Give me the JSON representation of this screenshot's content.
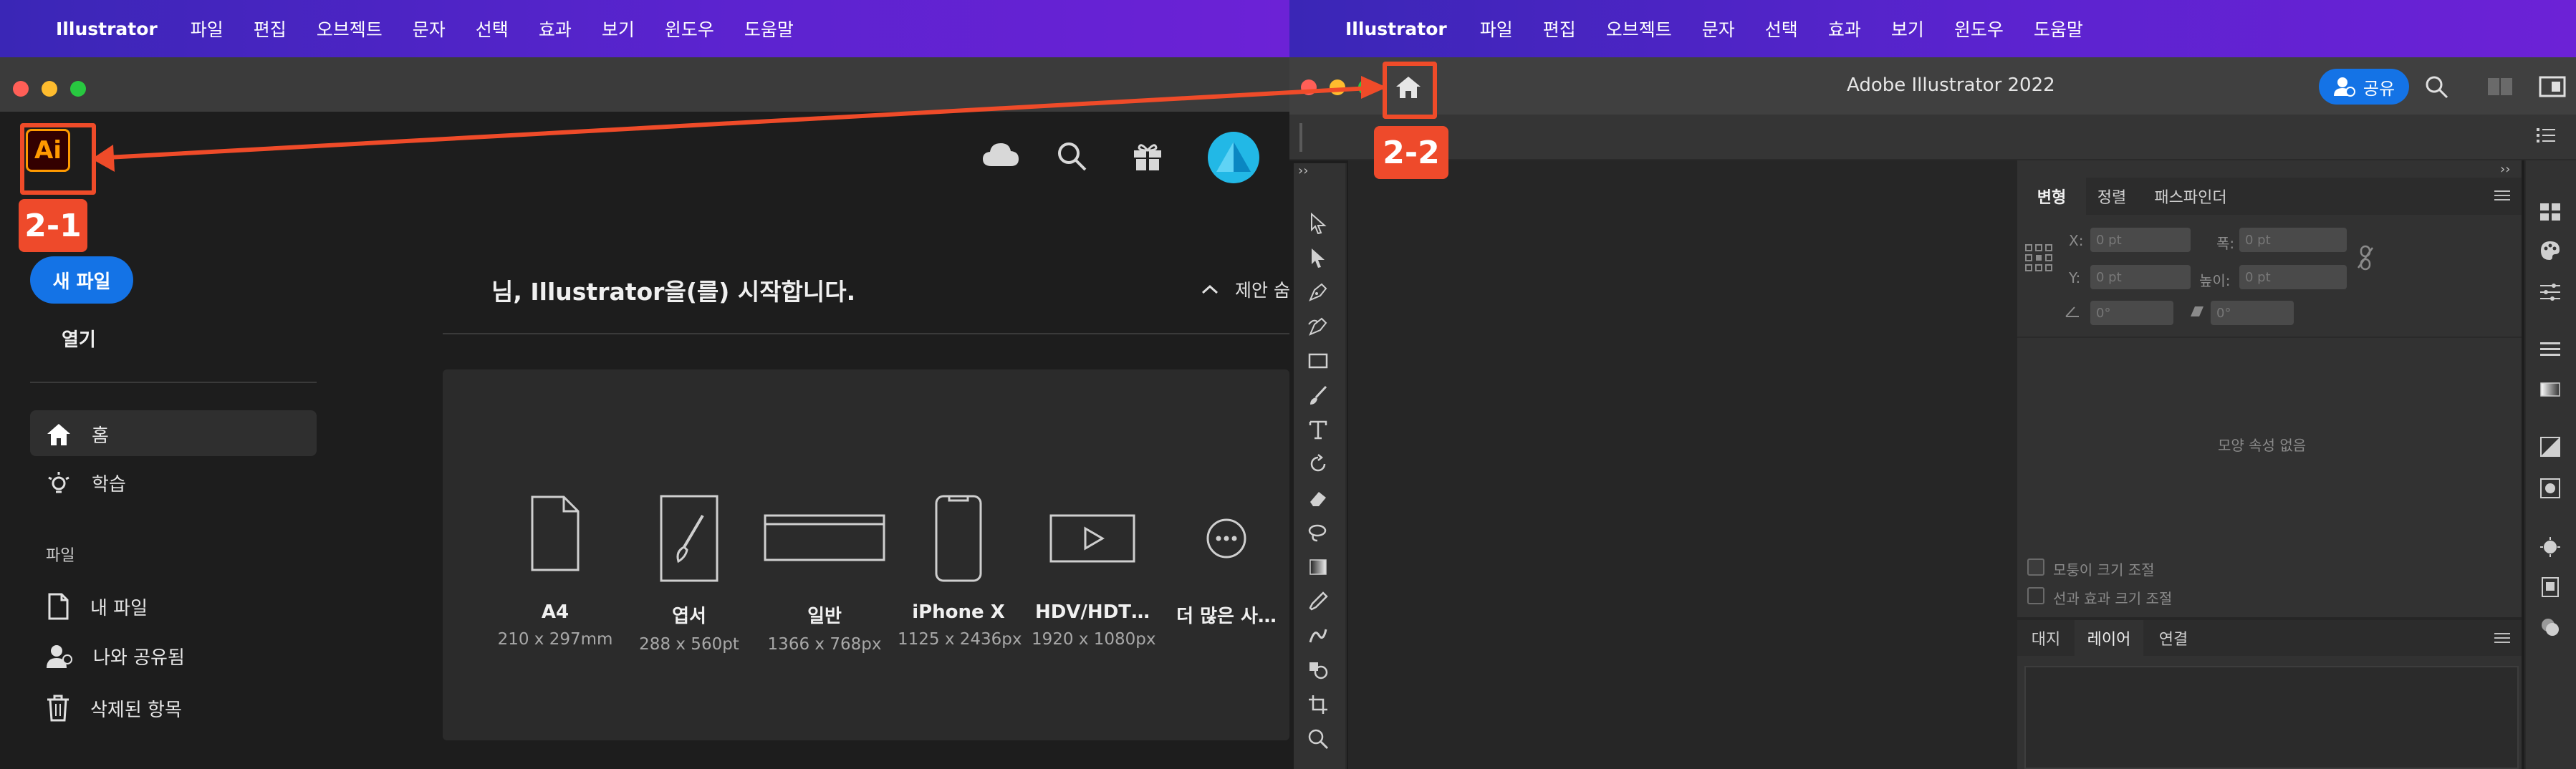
{
  "menubar": {
    "apple_glyph": "",
    "app_name": "Illustrator",
    "items": [
      "파일",
      "편집",
      "오브젝트",
      "문자",
      "선택",
      "효과",
      "보기",
      "윈도우",
      "도움말"
    ]
  },
  "home_window": {
    "logo_text": "Ai",
    "new_file_label": "새 파일",
    "open_label": "열기",
    "nav_home": "홈",
    "nav_learn": "학습",
    "files_section": "파일",
    "nav_my_files": "내 파일",
    "nav_shared": "나와 공유됨",
    "nav_deleted": "삭제된 항목",
    "welcome": "님, Illustrator을(를) 시작합니다.",
    "suggest_label": "제안 숨",
    "presets": [
      {
        "name": "A4",
        "size": "210 x 297mm",
        "icon": "document-icon"
      },
      {
        "name": "엽서",
        "size": "288 x 560pt",
        "icon": "postcard-brush-icon"
      },
      {
        "name": "일반",
        "size": "1366 x 768px",
        "icon": "browser-window-icon"
      },
      {
        "name": "iPhone X",
        "size": "1125 x 2436px",
        "icon": "phone-icon"
      },
      {
        "name": "HDV/HDT…",
        "size": "1920 x 1080px",
        "icon": "video-play-icon"
      },
      {
        "name": "더 많은 사…",
        "size": "",
        "icon": "more-icon"
      }
    ]
  },
  "workspace_window": {
    "title": "Adobe Illustrator 2022",
    "share_label": "공유",
    "panel_tabs": [
      "변형",
      "정렬",
      "패스파인더"
    ],
    "x_label": "X:",
    "y_label": "Y:",
    "w_label": "폭:",
    "h_label": "높이:",
    "field_placeholder": "0 pt",
    "angle_placeholder": "0°",
    "no_properties": "모양 속성 없음",
    "scale_corners": "모퉁이 크기 조절",
    "scale_strokes": "선과 효과 크기 조절",
    "bottom_tabs": [
      "대지",
      "레이어",
      "연결"
    ]
  },
  "annotations": {
    "label_1": "2-1",
    "label_2": "2-2",
    "accent_color": "#ee4a2b"
  },
  "colors": {
    "menubar": "#4b25c8",
    "primary_button": "#1473e6",
    "logo_bg": "#330000",
    "logo_fg": "#ff9a00"
  }
}
